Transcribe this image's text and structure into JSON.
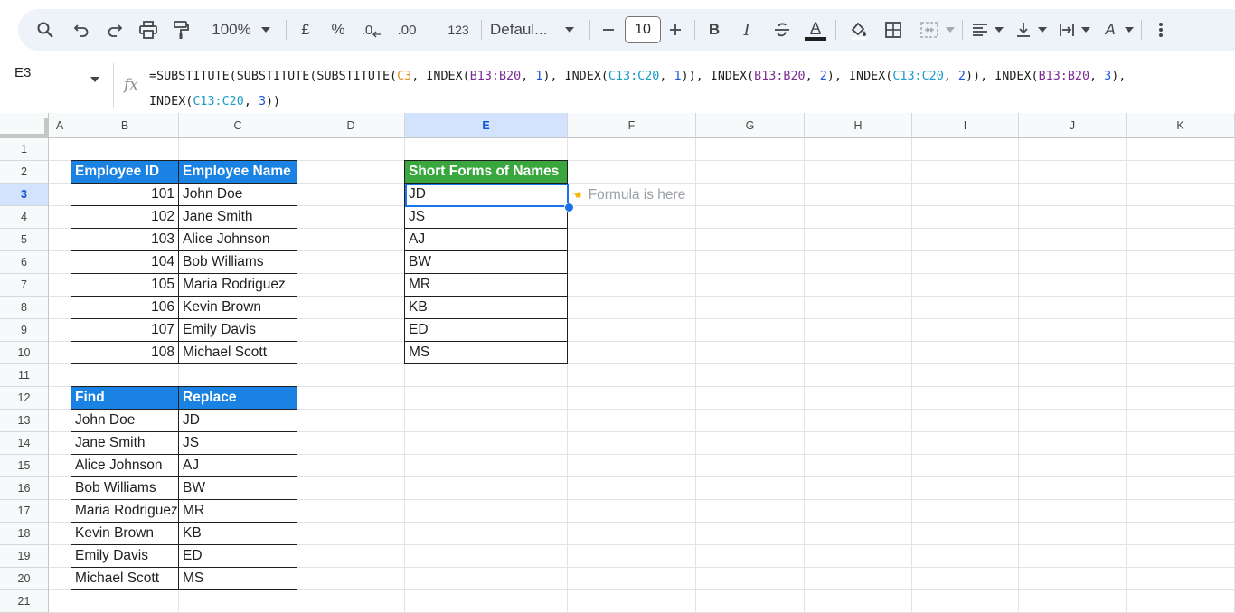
{
  "toolbar": {
    "zoom": "100%",
    "currency": "£",
    "percent": "%",
    "decrease_decimal": ".0",
    "increase_decimal": ".00",
    "number_format": "123",
    "font": "Defaul...",
    "font_size": "10",
    "bold": "B",
    "italic": "I",
    "text_color": "A",
    "text_rotation": "A",
    "icons": [
      "search-icon",
      "undo-icon",
      "redo-icon",
      "print-icon",
      "paint-format-icon",
      "dropdown-icon",
      "minus-icon",
      "plus-icon",
      "strikethrough-icon",
      "fill-color-icon",
      "borders-icon",
      "merge-icon",
      "align-icon",
      "valign-icon",
      "wrap-icon",
      "more-icon"
    ]
  },
  "formula_bar": {
    "name_box": "E3",
    "fx": "fx",
    "line1": {
      "p1": "=SUBSTITUTE(SUBSTITUTE(SUBSTITUTE(",
      "r1": "C3",
      "p2": ", INDEX(",
      "r2": "B13:B20",
      "p3": ", ",
      "n1": "1",
      "p4": "), INDEX(",
      "r3": "C13:C20",
      "p5": ", ",
      "n2": "1",
      "p6": ")), INDEX(",
      "r4": "B13:B20",
      "p7": ", ",
      "n3": "2",
      "p8": "), INDEX(",
      "r5": "C13:C20",
      "p9": ", ",
      "n4": "2",
      "p10": ")), INDEX(",
      "r6": "B13:B20",
      "p11": ", ",
      "n5": "3",
      "p12": "),"
    },
    "line2": {
      "p1": "INDEX(",
      "r1": "C13:C20",
      "p2": ", ",
      "n1": "3",
      "p3": "))"
    }
  },
  "columns": [
    "A",
    "B",
    "C",
    "D",
    "E",
    "F",
    "G",
    "H",
    "I",
    "J",
    "K"
  ],
  "selected_column": "E",
  "rows": [
    "1",
    "2",
    "3",
    "4",
    "5",
    "6",
    "7",
    "8",
    "9",
    "10",
    "11",
    "12",
    "13",
    "14",
    "15",
    "16",
    "17",
    "18",
    "19",
    "20",
    "21"
  ],
  "selected_row": "3",
  "employees": {
    "header_id": "Employee ID",
    "header_name": "Employee Name",
    "rows": [
      {
        "id": "101",
        "name": "John Doe"
      },
      {
        "id": "102",
        "name": "Jane Smith"
      },
      {
        "id": "103",
        "name": "Alice Johnson"
      },
      {
        "id": "104",
        "name": "Bob Williams"
      },
      {
        "id": "105",
        "name": "Maria Rodriguez"
      },
      {
        "id": "106",
        "name": "Kevin Brown"
      },
      {
        "id": "107",
        "name": "Emily Davis"
      },
      {
        "id": "108",
        "name": "Michael Scott"
      }
    ]
  },
  "short_forms": {
    "header": "Short Forms of Names",
    "values": [
      "JD",
      "JS",
      "AJ",
      "BW",
      "MR",
      "KB",
      "ED",
      "MS"
    ]
  },
  "note": {
    "icon": "pointing-hand-icon",
    "text": "Formula is here"
  },
  "find_replace": {
    "header_find": "Find",
    "header_replace": "Replace",
    "rows": [
      {
        "find": "John Doe",
        "replace": "JD"
      },
      {
        "find": "Jane Smith",
        "replace": "JS"
      },
      {
        "find": "Alice Johnson",
        "replace": "AJ"
      },
      {
        "find": "Bob Williams",
        "replace": "BW"
      },
      {
        "find": "Maria Rodriguez",
        "replace": "MR"
      },
      {
        "find": "Kevin Brown",
        "replace": "KB"
      },
      {
        "find": "Emily Davis",
        "replace": "ED"
      },
      {
        "find": "Michael Scott",
        "replace": "MS"
      }
    ]
  },
  "colors": {
    "header_blue": "#1a82e2",
    "header_green": "#3aa63e",
    "selection": "#1a73e8"
  }
}
